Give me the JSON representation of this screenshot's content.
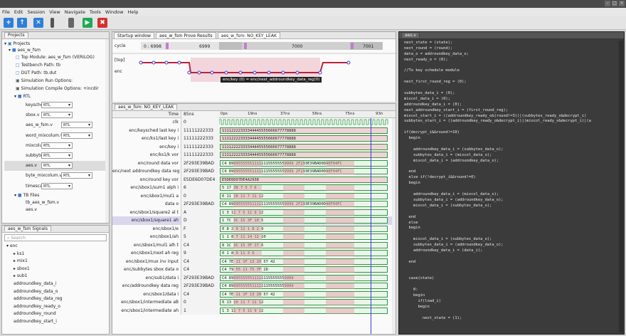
{
  "menu": [
    "File",
    "Edit",
    "Session",
    "View",
    "Navigate",
    "Tools",
    "Window",
    "Help"
  ],
  "window_buttons": [
    "–",
    "□",
    "×"
  ],
  "toolbar": {
    "icons": [
      "new-icon",
      "open-icon",
      "save-icon",
      "separator-icon",
      "lock-icon",
      "run-icon",
      "stop-icon"
    ],
    "colors": {
      "blue": "#2f7fd8",
      "green": "#1eaa55",
      "red": "#d63030"
    }
  },
  "projects": {
    "tab": "Projects",
    "root": "Projects",
    "project": "aes_w_fsm",
    "top_module": "Top Module: aes_w_fsm (VERILOG)",
    "testbench": "Testbench Path: tb",
    "dut": "DUT Path: tb.dut",
    "sim_run": "Simulation Run Options:",
    "sim_compile": "Simulation Compile Options:",
    "sim_compile_val": "+incdir",
    "rtl": "RTL",
    "rtl_files": [
      {
        "name": "keysched.v",
        "opt": "RTL"
      },
      {
        "name": "sbox.v",
        "opt": "RTL"
      },
      {
        "name": "aes_w_fsm.v",
        "opt": "RTL"
      },
      {
        "name": "word_mixcolum.v",
        "opt": "RTL"
      },
      {
        "name": "mixcolum.v",
        "opt": "RTL"
      },
      {
        "name": "subbytes.v",
        "opt": "RTL"
      },
      {
        "name": "aes.v",
        "opt": "RTL"
      },
      {
        "name": "byte_mixcolum.v",
        "opt": "RTL"
      },
      {
        "name": "timescale.v",
        "opt": "RTL"
      }
    ],
    "tb_files": "TB Files",
    "tb_items": [
      "tb_aes_w_fsm.v",
      "aes.v"
    ]
  },
  "signals": {
    "tab": "aes_w_fsm Signals",
    "search_placeholder": "Search",
    "tree": [
      {
        "label": "enc",
        "level": 0
      },
      {
        "label": "ks1",
        "level": 1
      },
      {
        "label": "mix1",
        "level": 1
      },
      {
        "label": "sbox1",
        "level": 1
      },
      {
        "label": "sub1",
        "level": 1
      },
      {
        "label": "addroundkey_data_i",
        "level": 1
      },
      {
        "label": "addroundkey_data_o",
        "level": 1
      },
      {
        "label": "addroundkey_data_reg",
        "level": 1
      },
      {
        "label": "addroundkey_ready_o",
        "level": 1
      },
      {
        "label": "addroundkey_round",
        "level": 1
      },
      {
        "label": "addroundkey_start_i",
        "level": 1
      }
    ]
  },
  "center_tabs": [
    "Startup window",
    "aes_w_fsm Prove Results",
    "aes_w_fsm: NO_KEY_LEAK"
  ],
  "trace": {
    "cycle_label": "cycle",
    "top_label": "[top]",
    "enc_label": "enc",
    "cycles": [
      "0 : 6998",
      "6999",
      "7000",
      "7001"
    ],
    "tooltip": "enc/key (0) = enc/next_addroundkey_data_reg(0)"
  },
  "waves": {
    "tab": "aes_w_fsm: NO_KEY_LEAK",
    "time_label": "Time",
    "time_value": "85ns",
    "ticks": [
      "0ps",
      "19ns",
      "37ns",
      "56ns",
      "75ns",
      "93n"
    ],
    "rows": [
      {
        "name": "clk",
        "value": "0",
        "hex": ""
      },
      {
        "name": "enc/keysched last key i",
        "value": "11111222333",
        "hex": "11112222333344445555666677778888"
      },
      {
        "name": "enc/ks1/last key i",
        "value": "11111222333",
        "hex": "11112222333344445555666677778888"
      },
      {
        "name": "enc/key i",
        "value": "11111222333",
        "hex": "11112222333344445555666677778888"
      },
      {
        "name": "enc/ks1/k vor",
        "value": "11111222333",
        "hex": "11112222333344445555666677778888"
      },
      {
        "name": "enc/round data vor",
        "value": "2F293E39BAD",
        "hex": "C4 8999555555111111155555559999     2F293E39BAD0D40F04FC"
      },
      {
        "name": "enc/next addroundkey data reg",
        "value": "2F293E39BAD",
        "hex": "C4 8999555555111111155555559999     2F293E39BAD0D40F04FC"
      },
      {
        "name": "enc/round key vor",
        "value": "E5DE6D07DE4",
        "hex": "E5DE6D07DE4A2938"
      },
      {
        "name": "enc/sbox1/sum1 alph i",
        "value": "6",
        "hex": "5 17 38 7 5 7 6"
      },
      {
        "name": "enc/sbox1/mul1 a",
        "value": "0",
        "hex": "0 11 10 11 7 11 12"
      },
      {
        "name": "data o",
        "value": "2F293E39BAD",
        "hex": "C4 8999555555111111155555559999     2F293E39BAD0D40F04FC"
      },
      {
        "name": "enc/sbox1/square2 al t",
        "value": "A",
        "hex": "1 3 11 7 5 11 9 12"
      },
      {
        "name": "enc/sbox1/square1 ah",
        "value": "D",
        "hex": "1 7C 3C 15 3F 10 5"
      },
      {
        "name": "enc/sbox1/e",
        "value": "F",
        "hex": "0 8 2 9 12 1 8 2 9"
      },
      {
        "name": "enc/sbox1/ah",
        "value": "5",
        "hex": "1 1 8 7 11 14 12 10"
      },
      {
        "name": "enc/sbox1/mul1 alh t",
        "value": "C4",
        "hex": "8 1C 3C 15 3F 17 6"
      },
      {
        "name": "enc/sbox1/next ah reg",
        "value": "9",
        "hex": "0 1 8 9 11 3 6"
      },
      {
        "name": "enc/sbox1/mux inv input",
        "value": "C4",
        "hex": "C4 7E 11 1F 13 20 57 42"
      },
      {
        "name": "enc/subbytes sbox data o",
        "value": "C4",
        "hex": "C4 79 55 11 75 7F 2D"
      },
      {
        "name": "enc/sub1/data i",
        "value": "2F293E39BAD",
        "hex": "C4 8999555555111111155555559999"
      },
      {
        "name": "enc/addroundkey data reg",
        "value": "2F293E39BAD",
        "hex": "C4 8999555555111111155555559999"
      },
      {
        "name": "enc/sbox1/data i",
        "value": "C4",
        "hex": "C4 7E 11 1F 13 20 57 42"
      },
      {
        "name": "enc/sbox1/intermediate aB",
        "value": "0",
        "hex": "0 13 10 11 7 11 12"
      },
      {
        "name": "enc/sbox1/intermediate ah",
        "value": "1",
        "hex": "1 3 11 7 5 11 9 12"
      }
    ]
  },
  "code": {
    "tab": "aes.v",
    "lines": [
      "next_state = (state);",
      "next_round = (round);",
      "data_o = addroundkey_data_o;",
      "next_ready_o = (0);",
      "",
      "//To key schedule module",
      "",
      "next_first_round_reg = (0);",
      "",
      "subbytes_data_i = (0);",
      "mixcol_data_i = (0);",
      "addroundkey_data_i = (0);",
      "next_addroundkey_start_i = (first_round_reg);",
      "mixcol_start_i = ((addroundkey_ready_o&(round!=3))|(subbytes_ready_o&decrypt_i)",
      "subbytes_start_i = ((addroundkey_ready_o&decrypt_i)|(mixcol_ready_o&decrypt_i)|(a",
      "",
      "if(decrypt_i&&round!=10)",
      "  begin",
      "",
      "    addroundkey_data_i = (subbytes_data_o);",
      "    subbytes_data_i = (mixcol_data_o);",
      "    mixcol_data_i = (addroundkey_data_o);",
      "",
      "  end",
      "  else if(!decrypt_i&&round!=0)",
      "  begin",
      "",
      "    addroundkey_data_i = (mixcol_data_o);",
      "    subbytes_data_i = (addroundkey_data_o);",
      "    mixcol_data_i = (subbytes_data_o);",
      "",
      "  end",
      "  else",
      "  begin",
      "",
      "    mixcol_data_i = (subbytes_data_o);",
      "    subbytes_data_i = (addroundkey_data_o);",
      "    addroundkey_data_i = (data_i);",
      "",
      "  end",
      "",
      "",
      "  case(state)",
      "",
      "    0:",
      "    begin",
      "      if(load_i)",
      "      begin",
      "",
      "        next_state = (1);"
    ]
  }
}
